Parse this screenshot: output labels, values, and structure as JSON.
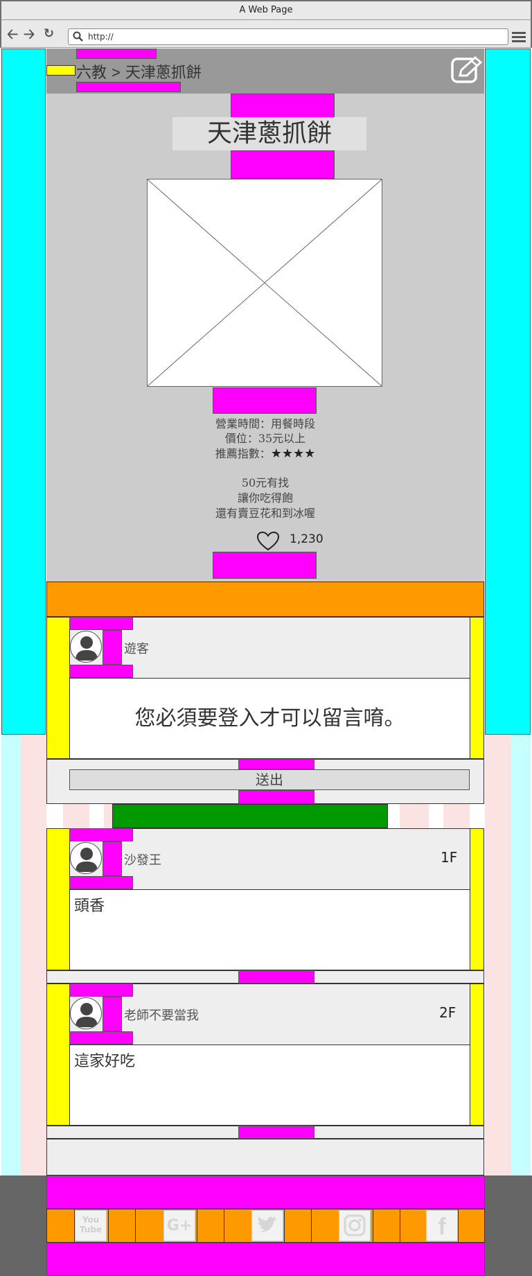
{
  "browser": {
    "title": "A Web Page",
    "url": "http://"
  },
  "breadcrumb": {
    "parent": "六教",
    "separator": ">",
    "current": "天津蔥抓餅"
  },
  "shop": {
    "name": "天津蔥抓餅",
    "hours": "營業時間：用餐時段",
    "price": "價位：35元以上",
    "rating_label": "推薦指數：",
    "rating_stars": "★★★★",
    "desc_line1": "50元有找",
    "desc_line2": "讓你吃得飽",
    "desc_line3": "還有賣豆花和到冰喔",
    "likes": "1,230"
  },
  "comment_form": {
    "user": "遊客",
    "message": "您必須要登入才可以留言唷。",
    "submit_label": "送出"
  },
  "comments": [
    {
      "user": "沙發王",
      "floor": "1F",
      "text": "頭香"
    },
    {
      "user": "老師不要當我",
      "floor": "2F",
      "text": "這家好吃"
    }
  ],
  "social": [
    "youtube-icon",
    "google-plus-icon",
    "twitter-icon",
    "instagram-icon",
    "facebook-icon"
  ],
  "social_labels": {
    "youtube": "You Tube",
    "google": "G+",
    "facebook": "f"
  },
  "colors": {
    "placeholder_magenta": "#ff00ff",
    "placeholder_yellow": "#ffff00",
    "placeholder_orange": "#ff9900",
    "placeholder_green": "#009900",
    "side_cyan": "#00ffff"
  }
}
